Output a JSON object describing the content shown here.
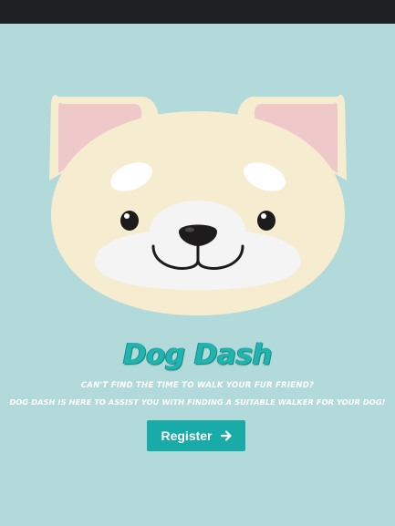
{
  "hero": {
    "title": "Dog Dash",
    "tagline_line1": "Can't find the time to walk your fur friend?",
    "tagline_line2": "Dog Dash is here to assist you with finding a suitable walker for your dog!"
  },
  "actions": {
    "register_label": "Register",
    "register_icon": "arrow-right-icon"
  },
  "colors": {
    "background": "#b3dadb",
    "topbar": "#1e2023",
    "accent": "#19aba7",
    "dog_face": "#f6ecd0",
    "dog_ear_inner": "#efc9c9",
    "dog_muzzle": "#f4f4f4"
  }
}
